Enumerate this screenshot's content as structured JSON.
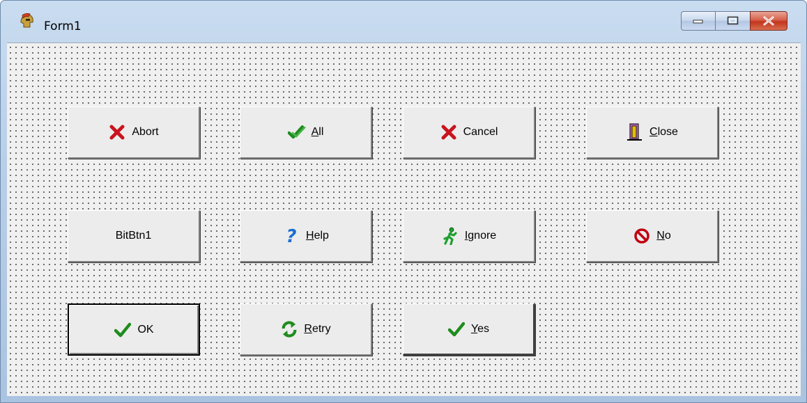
{
  "window": {
    "title": "Form1",
    "icon": "spartan-helmet-icon",
    "caption_buttons": [
      "minimize",
      "maximize",
      "close"
    ]
  },
  "colors": {
    "abort_x": "#c8141e",
    "check_green": "#1e8c1e",
    "help_blue": "#1a6fd0",
    "ignore_green": "#20a030",
    "no_red": "#c00010",
    "close_door_purple": "#c060c0",
    "close_door_yellow": "#e0c000"
  },
  "buttons": [
    {
      "id": "abort",
      "accel": "",
      "rest": "Abort",
      "icon": "x-mark-icon"
    },
    {
      "id": "all",
      "accel": "A",
      "rest": "ll",
      "icon": "double-check-icon"
    },
    {
      "id": "cancel",
      "accel": "",
      "rest": "Cancel",
      "icon": "x-mark-icon"
    },
    {
      "id": "close",
      "accel": "C",
      "rest": "lose",
      "icon": "door-exit-icon"
    },
    {
      "id": "bitbtn1",
      "accel": "",
      "rest": "BitBtn1",
      "icon": ""
    },
    {
      "id": "help",
      "accel": "H",
      "rest": "elp",
      "icon": "question-mark-icon"
    },
    {
      "id": "ignore",
      "accel": "I",
      "rest": "gnore",
      "icon": "running-man-icon"
    },
    {
      "id": "no",
      "accel": "N",
      "rest": "o",
      "icon": "no-entry-icon"
    },
    {
      "id": "ok",
      "accel": "",
      "rest": "OK",
      "icon": "check-mark-icon"
    },
    {
      "id": "retry",
      "accel": "R",
      "rest": "etry",
      "icon": "refresh-arrows-icon"
    },
    {
      "id": "yes",
      "accel": "Y",
      "rest": "es",
      "icon": "check-mark-icon"
    }
  ]
}
